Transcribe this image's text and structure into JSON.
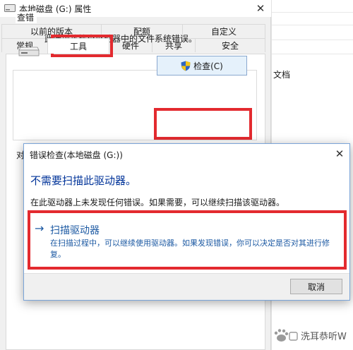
{
  "properties_window": {
    "title": "本地磁盘 (G:) 属性",
    "close_glyph": "✕",
    "tabs_row1": [
      "以前的版本",
      "配额",
      "自定义"
    ],
    "tabs_row2": [
      "常规",
      "工具",
      "硬件",
      "共享",
      "安全"
    ],
    "active_tab": "工具",
    "error_check_group": {
      "title": "查错",
      "description": "此选项将检查驱动器中的文件系统错误。",
      "button_label": "检查(C)",
      "button_icon": "uac-shield-icon"
    },
    "partial_group_label": "对"
  },
  "background_window": {
    "label": "文档"
  },
  "dialog": {
    "title": "错误检查(本地磁盘 (G:))",
    "close_glyph": "✕",
    "heading": "不需要扫描此驱动器。",
    "info": "在此驱动器上未发现任何错误。如果需要，可以继续扫描该驱动器。",
    "scan_option": {
      "arrow": "→",
      "title": "扫描驱动器",
      "description": "在扫描过程中，可以继续使用驱动器。如果发现错误，你可以决定是否对其进行修复。"
    },
    "cancel_label": "取消"
  },
  "watermark": {
    "text": "洗耳恭听W"
  },
  "colors": {
    "highlight": "#e32a2f",
    "link_blue": "#1d5aa3",
    "heading_blue": "#003399"
  }
}
